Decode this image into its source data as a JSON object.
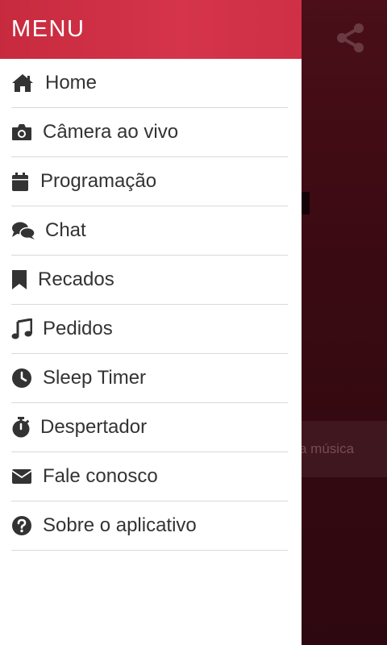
{
  "drawer": {
    "title": "MENU",
    "items": [
      {
        "label": "Home",
        "icon": "home-icon"
      },
      {
        "label": "Câmera ao vivo",
        "icon": "camera-icon"
      },
      {
        "label": "Programação",
        "icon": "calendar-icon"
      },
      {
        "label": "Chat",
        "icon": "chat-icon"
      },
      {
        "label": "Recados",
        "icon": "bookmark-icon"
      },
      {
        "label": "Pedidos",
        "icon": "music-note-icon"
      },
      {
        "label": "Sleep Timer",
        "icon": "clock-icon"
      },
      {
        "label": "Despertador",
        "icon": "stopwatch-icon"
      },
      {
        "label": "Fale conosco",
        "icon": "envelope-icon"
      },
      {
        "label": "Sobre o aplicativo",
        "icon": "question-circle-icon"
      }
    ]
  },
  "background": {
    "strip_text": "a música",
    "share_icon": "share-icon"
  },
  "colors": {
    "header": "#d5344a",
    "icon": "#333333",
    "text": "#333333",
    "divider": "#d9d9d9"
  }
}
